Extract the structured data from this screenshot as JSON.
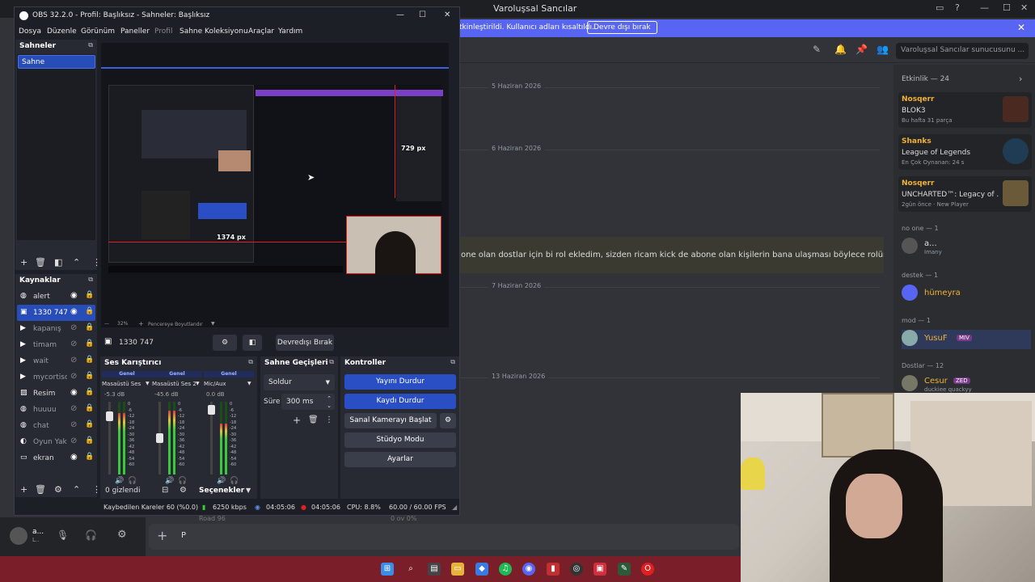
{
  "discord": {
    "window_title": "Varoluşsal Sancılar",
    "banner_text": "tkinleştirildi. Kullanıcı adları kısaltıldı.",
    "banner_button": "Devre dışı bırak",
    "search_placeholder": "Varoluşsal Sancılar sunucusunu ...",
    "dates": [
      "5 Haziran 2026",
      "6 Haziran 2026",
      "7 Haziran 2026",
      "13 Haziran 2026"
    ],
    "pinned_message": "one olan dostlar için bi rol ekledim, sizden ricam kick de abone olan kişilerin bana ulaşması böylece rolünüzü",
    "activity_header": "Etkinlik — 24",
    "activities": [
      {
        "name": "Nosqerr",
        "game": "BLOK3",
        "sub": "Bu hafta 31 parça"
      },
      {
        "name": "Shanks",
        "game": "League of Legends",
        "sub": "En Çok Oynanan: 24 s"
      },
      {
        "name": "Nosqerr",
        "game": "UNCHARTED™: Legacy of ...",
        "sub": "2gün önce  ·  New Player"
      }
    ],
    "groups": [
      {
        "label": "no one — 1",
        "member": "a...",
        "sub": "Imany"
      },
      {
        "label": "destek — 1",
        "member": "hümeyra",
        "sub": ""
      },
      {
        "label": "mod — 1",
        "member": "YusuF",
        "sub": "",
        "badge": "MIV"
      },
      {
        "label": "Dostlar — 12",
        "member": "Cesur",
        "sub": "duckiee quackyy",
        "badge": "ZED"
      }
    ],
    "userbar_name": "a...",
    "userbar_sub": "L..",
    "input_text": "P",
    "partial_text": "Road 96",
    "partial_status": "0 ov  0%"
  },
  "obs": {
    "title": "OBS 32.2.0 - Profil: Başlıksız - Sahneler: Başlıksız",
    "menu": [
      "Dosya",
      "Düzenle",
      "Görünüm",
      "Paneller",
      "Profil",
      "Sahne Koleksiyonu",
      "Araçlar",
      "Yardım"
    ],
    "scenes_title": "Sahneler",
    "scenes": [
      "Sahne"
    ],
    "sources_title": "Kaynaklar",
    "sources": [
      {
        "name": "alert",
        "icon": "globe-icon",
        "visible": true
      },
      {
        "name": "1330 747",
        "icon": "camera-icon",
        "visible": true,
        "selected": true
      },
      {
        "name": "kapanış",
        "icon": "play-icon",
        "visible": false
      },
      {
        "name": "timam",
        "icon": "play-icon",
        "visible": false
      },
      {
        "name": "wait",
        "icon": "play-icon",
        "visible": false
      },
      {
        "name": "mycortiso",
        "icon": "play-icon",
        "visible": false
      },
      {
        "name": "Resim",
        "icon": "image-icon",
        "visible": true
      },
      {
        "name": "huuuu",
        "icon": "globe-icon",
        "visible": false
      },
      {
        "name": "chat",
        "icon": "globe-icon",
        "visible": false
      },
      {
        "name": "Oyun Yak.",
        "icon": "gamepad-icon",
        "visible": false
      },
      {
        "name": "ekran",
        "icon": "monitor-icon",
        "visible": true
      }
    ],
    "preview": {
      "width_label": "1374 px",
      "height_label": "729 px",
      "zoom": "32%",
      "fit_label": "Pencereye Boyutlandır"
    },
    "source_toolbar": {
      "name": "1330 747",
      "deactivate": "Devredışı Bırak"
    },
    "mixer_title": "Ses Karıştırıcı",
    "mixer": [
      {
        "group": "Genel",
        "name": "Masaüstü Ses",
        "db": "-5.3 dB",
        "level": 0.85,
        "fader": 0.85
      },
      {
        "group": "Genel",
        "name": "Masaüstü Ses 2",
        "db": "-45.6 dB",
        "level": 0.88,
        "fader": 0.5
      },
      {
        "group": "Genel",
        "name": "Mic/Aux",
        "db": "0.0 dB",
        "level": 0.7,
        "fader": 0.95
      }
    ],
    "mixer_scale": [
      "0",
      "-6",
      "-12",
      "-18",
      "-24",
      "-30",
      "-36",
      "-42",
      "-48",
      "-54",
      "-60"
    ],
    "transitions_title": "Sahne Geçişleri",
    "transition_value": "Soldur",
    "duration_label": "Süre",
    "duration_value": "300 ms",
    "controls_title": "Kontroller",
    "controls": {
      "stop_stream": "Yayını Durdur",
      "stop_record": "Kaydı Durdur",
      "virtual_cam": "Sanal Kamerayı Başlat",
      "studio_mode": "Stüdyo Modu",
      "settings": "Ayarlar"
    },
    "bottom": {
      "hidden_label": "0 gizlendi",
      "options": "Seçenekler"
    },
    "status": {
      "dropped": "Kaybedilen Kareler 60 (%0.0)",
      "bitrate": "6250 kbps",
      "stream_time": "04:05:06",
      "rec_time": "04:05:06",
      "cpu": "CPU: 8.8%",
      "fps": "60.00 / 60.00 FPS"
    }
  },
  "colors": {
    "obs_accent": "#284cb8",
    "discord_accent": "#5865f2",
    "taskbar": "#7a1f2a"
  }
}
